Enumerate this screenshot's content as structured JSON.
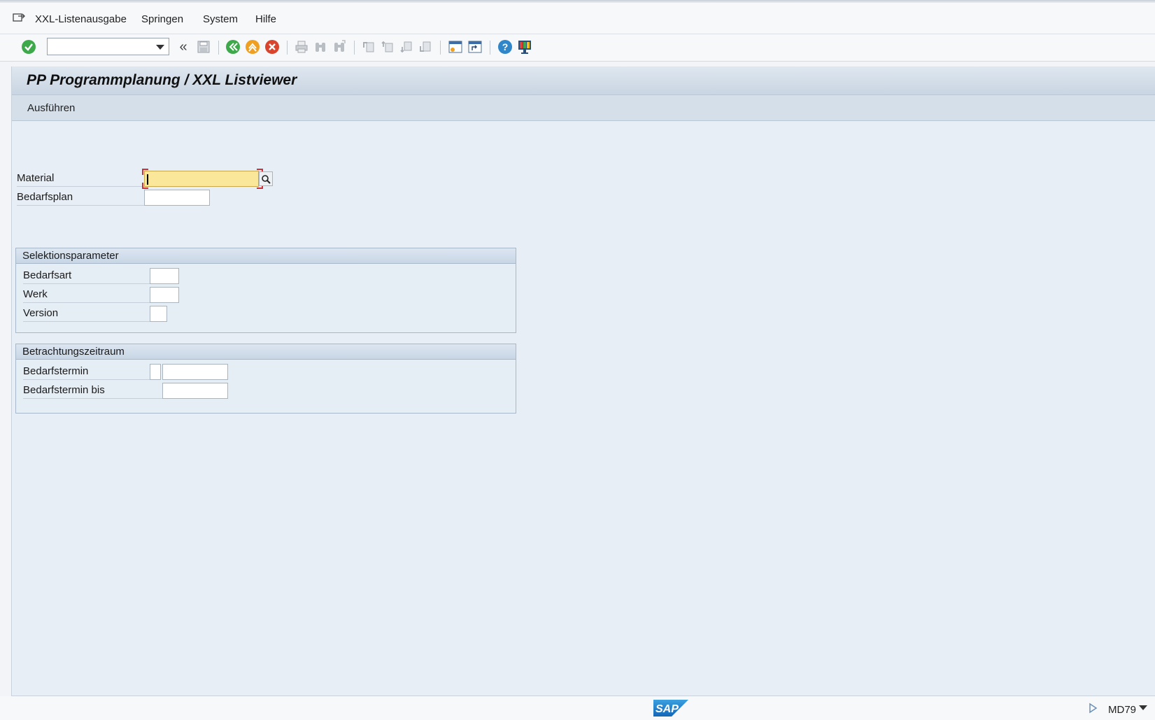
{
  "menu": {
    "items": [
      {
        "label": "XXL-Listenausgabe"
      },
      {
        "label": "Springen"
      },
      {
        "label": "System"
      },
      {
        "label": "Hilfe"
      }
    ]
  },
  "toolbar": {
    "command_field": "",
    "icons": [
      "enter-icon",
      "command-field",
      "collapse-icon",
      "save-icon",
      "back-icon",
      "exit-icon",
      "cancel-icon",
      "print-icon",
      "find-icon",
      "find-next-icon",
      "first-page-icon",
      "previous-page-icon",
      "next-page-icon",
      "last-page-icon",
      "new-session-icon",
      "shortcut-icon",
      "help-icon",
      "customize-layout-icon"
    ]
  },
  "page": {
    "title": "PP Programmplanung / XXL Listviewer",
    "execute_label": "Ausführen"
  },
  "fields": {
    "material": {
      "label": "Material",
      "value": ""
    },
    "bedarfsplan": {
      "label": "Bedarfsplan",
      "value": ""
    }
  },
  "selektionsparameter": {
    "title": "Selektionsparameter",
    "bedarfsart": {
      "label": "Bedarfsart",
      "value": ""
    },
    "werk": {
      "label": "Werk",
      "value": ""
    },
    "version": {
      "label": "Version",
      "value": ""
    }
  },
  "betrachtungszeitraum": {
    "title": "Betrachtungszeitraum",
    "bedarfstermin": {
      "label": "Bedarfstermin",
      "value": ""
    },
    "bedarfstermin_bis": {
      "label": "Bedarfstermin bis",
      "value": ""
    }
  },
  "status": {
    "logo": "SAP",
    "transaction": "MD79"
  },
  "colors": {
    "focus_field": "#fbe79a",
    "ok_green": "#3ea94a",
    "exit_orange": "#f0a020",
    "cancel_red": "#d9442c",
    "help_blue": "#2f86c8"
  }
}
